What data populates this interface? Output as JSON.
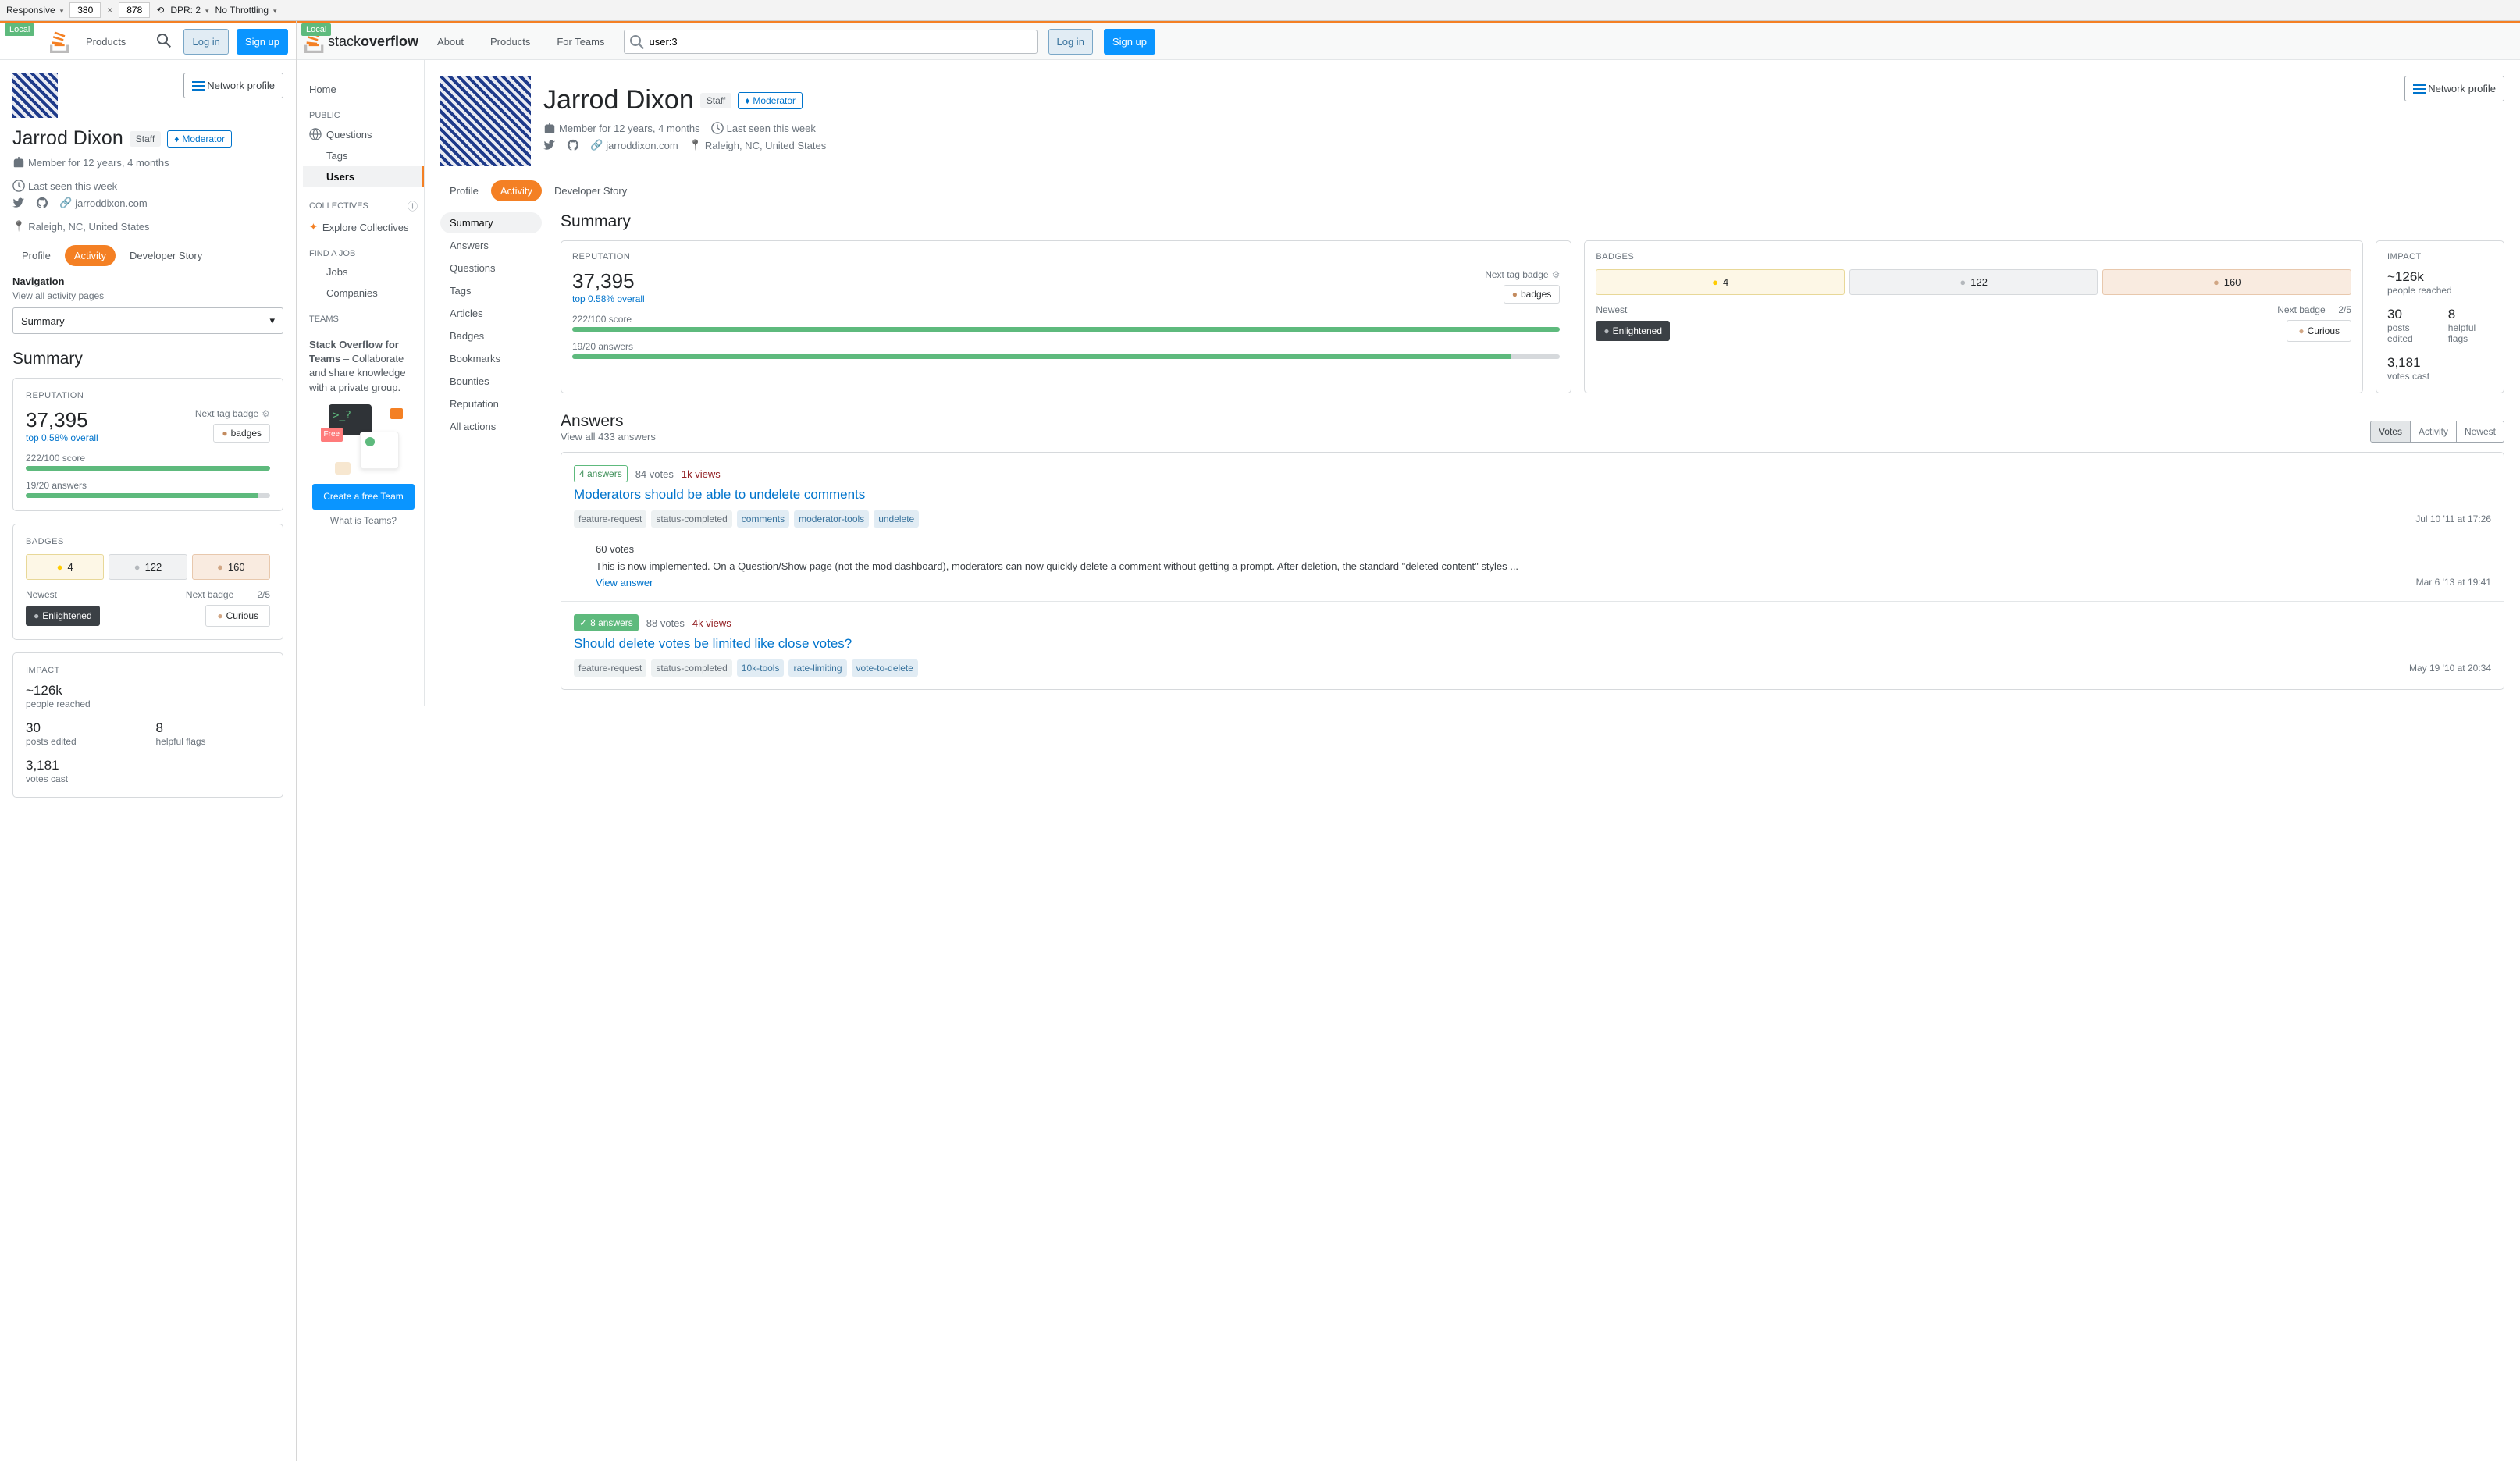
{
  "devtools": {
    "mode": "Responsive",
    "width": "380",
    "height": "878",
    "dpr_label": "DPR: 2",
    "throttling": "No Throttling"
  },
  "local_badge": "Local",
  "header": {
    "products": "Products",
    "about": "About",
    "for_teams": "For Teams",
    "search_value": "user:3",
    "login": "Log in",
    "signup": "Sign up",
    "logo_text_stack": "stack",
    "logo_text_overflow": "overflow"
  },
  "network_profile": "Network profile",
  "user": {
    "name": "Jarrod Dixon",
    "staff": "Staff",
    "moderator": "Moderator",
    "member_for": "Member for 12 years, 4 months",
    "last_seen": "Last seen this week",
    "website": "jarroddixon.com",
    "location": "Raleigh, NC, United States"
  },
  "tabs": {
    "profile": "Profile",
    "activity": "Activity",
    "developer_story": "Developer Story"
  },
  "mobile_nav": {
    "label": "Navigation",
    "sub": "View all activity pages",
    "selected": "Summary"
  },
  "sidebar": {
    "home": "Home",
    "public": "PUBLIC",
    "questions": "Questions",
    "tags": "Tags",
    "users": "Users",
    "collectives": "COLLECTIVES",
    "explore": "Explore Collectives",
    "find_job": "FIND A JOB",
    "jobs": "Jobs",
    "companies": "Companies",
    "teams": "TEAMS",
    "teams_title": "Stack Overflow for Teams",
    "teams_desc": " – Collaborate and share knowledge with a private group.",
    "free": "Free",
    "create_team": "Create a free Team",
    "what_is_teams": "What is Teams?"
  },
  "subnav": {
    "items": [
      "Summary",
      "Answers",
      "Questions",
      "Tags",
      "Articles",
      "Badges",
      "Bookmarks",
      "Bounties",
      "Reputation",
      "All actions"
    ]
  },
  "summary": {
    "heading": "Summary",
    "reputation": {
      "label": "REPUTATION",
      "value": "37,395",
      "top": "top 0.58% overall",
      "next_tag": "Next tag badge",
      "badges_pill": "badges",
      "score": "222/100 score",
      "answers": "19/20 answers",
      "score_pct": 100,
      "answers_pct": 95
    },
    "badges": {
      "label": "BADGES",
      "gold": "4",
      "silver": "122",
      "bronze": "160",
      "newest_label": "Newest",
      "newest_badge": "Enlightened",
      "next_label": "Next badge",
      "next_progress": "2/5",
      "next_badge": "Curious"
    },
    "impact": {
      "label": "IMPACT",
      "reached_num": "~126k",
      "reached_label": "people reached",
      "posts_num": "30",
      "posts_label": "posts edited",
      "flags_num": "8",
      "flags_label": "helpful flags",
      "votes_num": "3,181",
      "votes_label": "votes cast"
    }
  },
  "answers_section": {
    "heading": "Answers",
    "sub": "View all 433 answers",
    "filters": {
      "votes": "Votes",
      "activity": "Activity",
      "newest": "Newest"
    },
    "items": [
      {
        "count": "4 answers",
        "accepted": false,
        "votes": "84 votes",
        "views": "1k views",
        "title": "Moderators should be able to undelete comments",
        "tags": [
          "feature-request",
          "status-completed",
          "comments",
          "moderator-tools",
          "undelete"
        ],
        "date": "Jul 10 '11 at 17:26",
        "excerpt_votes": "60 votes",
        "excerpt": "This is now implemented. On a Question/Show page (not the mod dashboard), moderators can now quickly delete a comment without getting a prompt. After deletion, the standard \"deleted content\" styles ...",
        "view": "View answer",
        "excerpt_date": "Mar 6 '13 at 19:41"
      },
      {
        "count": "8 answers",
        "accepted": true,
        "votes": "88 votes",
        "views": "4k views",
        "title": "Should delete votes be limited like close votes?",
        "tags": [
          "feature-request",
          "status-completed",
          "10k-tools",
          "rate-limiting",
          "vote-to-delete"
        ],
        "date": "May 19 '10 at 20:34"
      }
    ]
  }
}
